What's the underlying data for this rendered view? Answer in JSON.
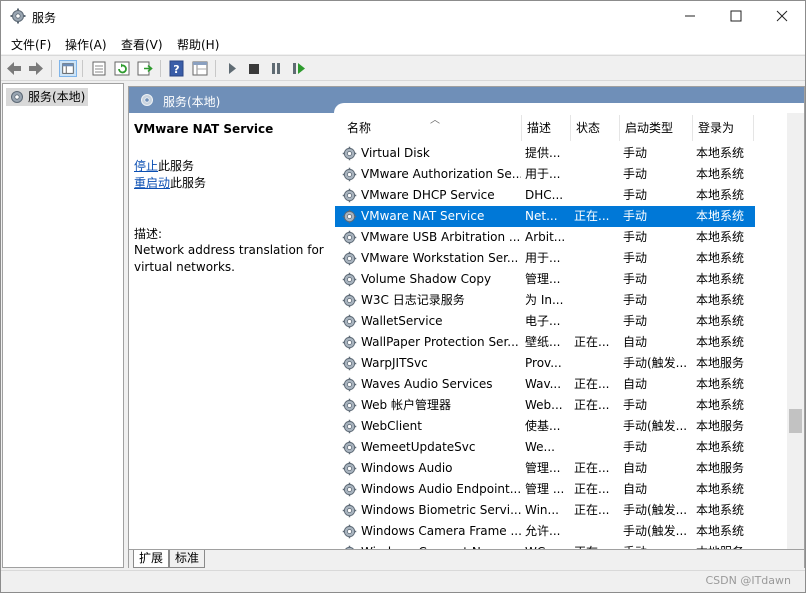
{
  "window": {
    "title": "服务"
  },
  "menu": {
    "file": "文件(F)",
    "action": "操作(A)",
    "view": "查看(V)",
    "help": "帮助(H)"
  },
  "tree": {
    "item": "服务(本地)"
  },
  "pane": {
    "title": "服务(本地)"
  },
  "details": {
    "service_name": "VMware NAT Service",
    "stop_link": "停止",
    "stop_suffix": "此服务",
    "restart_link": "重启动",
    "restart_suffix": "此服务",
    "desc_label": "描述:",
    "desc_text": "Network address translation for virtual networks."
  },
  "columns": {
    "name": "名称",
    "desc": "描述",
    "status": "状态",
    "startup": "启动类型",
    "login": "登录为"
  },
  "services": [
    {
      "name": "Virtual Disk",
      "desc": "提供...",
      "status": "",
      "startup": "手动",
      "login": "本地系统"
    },
    {
      "name": "VMware Authorization Se...",
      "desc": "用于...",
      "status": "",
      "startup": "手动",
      "login": "本地系统"
    },
    {
      "name": "VMware DHCP Service",
      "desc": "DHC...",
      "status": "",
      "startup": "手动",
      "login": "本地系统"
    },
    {
      "name": "VMware NAT Service",
      "desc": "Net...",
      "status": "正在...",
      "startup": "手动",
      "login": "本地系统",
      "selected": true
    },
    {
      "name": "VMware USB Arbitration ...",
      "desc": "Arbit...",
      "status": "",
      "startup": "手动",
      "login": "本地系统"
    },
    {
      "name": "VMware Workstation Ser...",
      "desc": "用于...",
      "status": "",
      "startup": "手动",
      "login": "本地系统"
    },
    {
      "name": "Volume Shadow Copy",
      "desc": "管理...",
      "status": "",
      "startup": "手动",
      "login": "本地系统"
    },
    {
      "name": "W3C 日志记录服务",
      "desc": "为 In...",
      "status": "",
      "startup": "手动",
      "login": "本地系统"
    },
    {
      "name": "WalletService",
      "desc": "电子...",
      "status": "",
      "startup": "手动",
      "login": "本地系统"
    },
    {
      "name": "WallPaper Protection Ser...",
      "desc": "壁纸...",
      "status": "正在...",
      "startup": "自动",
      "login": "本地系统"
    },
    {
      "name": "WarpJITSvc",
      "desc": "Prov...",
      "status": "",
      "startup": "手动(触发...",
      "login": "本地服务"
    },
    {
      "name": "Waves Audio Services",
      "desc": "Wav...",
      "status": "正在...",
      "startup": "自动",
      "login": "本地系统"
    },
    {
      "name": "Web 帐户管理器",
      "desc": "Web...",
      "status": "正在...",
      "startup": "手动",
      "login": "本地系统"
    },
    {
      "name": "WebClient",
      "desc": "使基...",
      "status": "",
      "startup": "手动(触发...",
      "login": "本地服务"
    },
    {
      "name": "WemeetUpdateSvc",
      "desc": "We...",
      "status": "",
      "startup": "手动",
      "login": "本地系统"
    },
    {
      "name": "Windows Audio",
      "desc": "管理...",
      "status": "正在...",
      "startup": "自动",
      "login": "本地服务"
    },
    {
      "name": "Windows Audio Endpoint...",
      "desc": "管理 ...",
      "status": "正在...",
      "startup": "自动",
      "login": "本地系统"
    },
    {
      "name": "Windows Biometric Servi...",
      "desc": "Win...",
      "status": "正在...",
      "startup": "手动(触发...",
      "login": "本地系统"
    },
    {
      "name": "Windows Camera Frame ...",
      "desc": "允许...",
      "status": "",
      "startup": "手动(触发...",
      "login": "本地系统"
    },
    {
      "name": "Windows Connect Now ...",
      "desc": "WC...",
      "status": "正在...",
      "startup": "手动",
      "login": "本地服务"
    }
  ],
  "tabs": {
    "extended": "扩展",
    "standard": "标准"
  },
  "watermark": "CSDN @ITdawn",
  "colors": {
    "selection": "#0078d7",
    "pane_header": "#6f8fb8",
    "link": "#0b4fb3"
  },
  "icons": [
    "services-gear-icon",
    "back-arrow-icon",
    "forward-arrow-icon",
    "console-tree-icon",
    "properties-icon",
    "refresh-icon",
    "export-list-icon",
    "help-icon",
    "view-icon",
    "start-icon",
    "stop-icon",
    "pause-icon",
    "restart-icon",
    "minimize-icon",
    "maximize-icon",
    "close-icon"
  ]
}
